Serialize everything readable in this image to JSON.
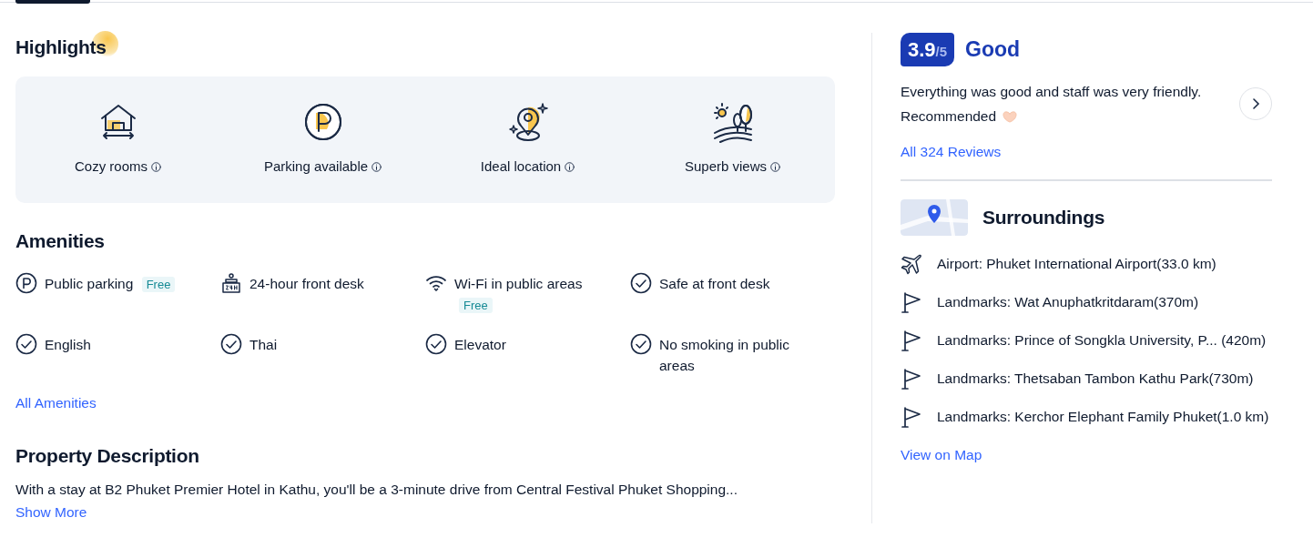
{
  "highlights": {
    "title": "Highlights",
    "items": [
      {
        "kind": "house",
        "label": "Cozy rooms"
      },
      {
        "kind": "parking",
        "label": "Parking available"
      },
      {
        "kind": "pin",
        "label": "Ideal location"
      },
      {
        "kind": "views",
        "label": "Superb views"
      }
    ]
  },
  "amenities": {
    "title": "Amenities",
    "items": [
      {
        "kind": "parking",
        "label": "Public parking",
        "tag": "Free"
      },
      {
        "kind": "desk",
        "label": "24-hour front desk"
      },
      {
        "kind": "wifi",
        "label": "Wi-Fi in public areas",
        "tag": "Free"
      },
      {
        "kind": "check",
        "label": "Safe at front desk"
      },
      {
        "kind": "check",
        "label": "English"
      },
      {
        "kind": "check",
        "label": "Thai"
      },
      {
        "kind": "check",
        "label": "Elevator"
      },
      {
        "kind": "check",
        "label": "No smoking in public areas"
      }
    ],
    "link": "All Amenities"
  },
  "description": {
    "title": "Property Description",
    "text": "With a stay at B2 Phuket Premier Hotel in Kathu, you'll be a 3-minute drive from Central Festival Phuket Shopping...",
    "link": "Show More"
  },
  "rating": {
    "score": "3.9",
    "out_of": "/5",
    "label": "Good",
    "review": [
      "Everything was good and staff was very friendly.",
      "Recommended"
    ],
    "link": "All 324 Reviews"
  },
  "surroundings": {
    "title": "Surroundings",
    "items": [
      {
        "kind": "airport",
        "text": "Airport: Phuket International Airport(33.0 km)"
      },
      {
        "kind": "landmark",
        "text": "Landmarks: Wat Anuphatkritdaram(370m)"
      },
      {
        "kind": "landmark",
        "text": "Landmarks: Prince of Songkla University, P... (420m)"
      },
      {
        "kind": "landmark",
        "text": "Landmarks: Thetsaban Tambon Kathu Park(730m)"
      },
      {
        "kind": "landmark",
        "text": "Landmarks: Kerchor Elephant Family Phuket(1.0 km)"
      }
    ],
    "link": "View on Map"
  }
}
